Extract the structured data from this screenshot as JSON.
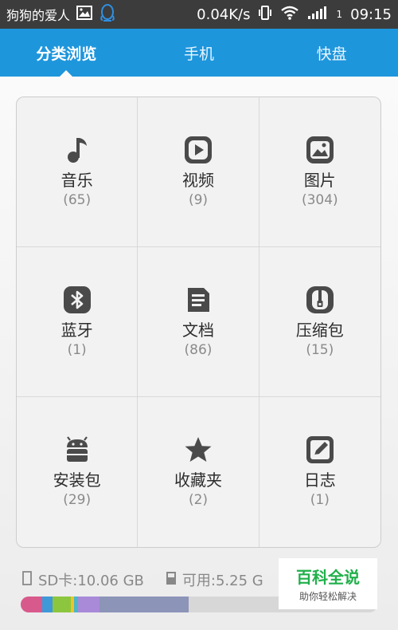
{
  "status_bar": {
    "title": "狗狗的爱人",
    "net_speed": "0.04K/s",
    "sim": "1",
    "time": "09:15"
  },
  "tabs": [
    {
      "label": "分类浏览",
      "active": true
    },
    {
      "label": "手机",
      "active": false
    },
    {
      "label": "快盘",
      "active": false
    }
  ],
  "categories": [
    {
      "name": "音乐",
      "count": "(65)",
      "icon": "music-icon"
    },
    {
      "name": "视频",
      "count": "(9)",
      "icon": "video-icon"
    },
    {
      "name": "图片",
      "count": "(304)",
      "icon": "image-icon"
    },
    {
      "name": "蓝牙",
      "count": "(1)",
      "icon": "bluetooth-icon"
    },
    {
      "name": "文档",
      "count": "(86)",
      "icon": "document-icon"
    },
    {
      "name": "压缩包",
      "count": "(15)",
      "icon": "zip-icon"
    },
    {
      "name": "安装包",
      "count": "(29)",
      "icon": "android-icon"
    },
    {
      "name": "收藏夹",
      "count": "(2)",
      "icon": "star-icon"
    },
    {
      "name": "日志",
      "count": "(1)",
      "icon": "note-icon"
    }
  ],
  "storage": {
    "sd_label": "SD卡:10.06 GB",
    "available_label": "可用:5.25 G"
  },
  "usage_segments": [
    {
      "color": "#d85a8c",
      "fraction": 0.06
    },
    {
      "color": "#3f98d8",
      "fraction": 0.03
    },
    {
      "color": "#8cc63e",
      "fraction": 0.05
    },
    {
      "color": "#f3c229",
      "fraction": 0.01
    },
    {
      "color": "#49b8c8",
      "fraction": 0.01
    },
    {
      "color": "#a88ad8",
      "fraction": 0.06
    },
    {
      "color": "#8c94b8",
      "fraction": 0.25
    }
  ],
  "watermark": {
    "main": "百科全说",
    "sub": "助你轻松解决"
  },
  "colors": {
    "accent": "#1e96dc",
    "icon": "#4a4a4a",
    "statusbar": "#3c3c3c"
  }
}
